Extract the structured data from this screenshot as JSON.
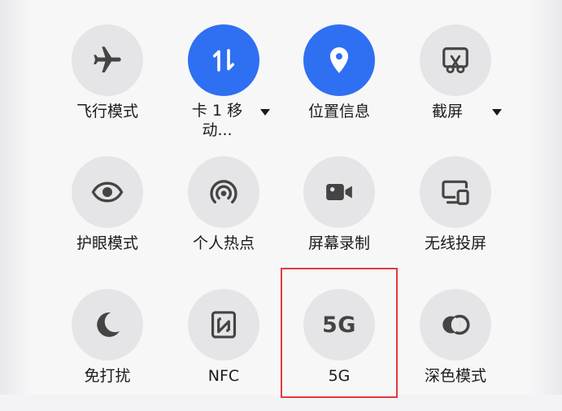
{
  "quick_settings": {
    "tiles": [
      {
        "id": "airplane",
        "label": "飞行模式",
        "icon": "airplane-icon",
        "active": false
      },
      {
        "id": "sim",
        "label_line1": "卡 1 移",
        "label_line2": "动...",
        "icon": "data-transfer-icon",
        "active": true,
        "has_dropdown": true
      },
      {
        "id": "location",
        "label": "位置信息",
        "icon": "location-pin-icon",
        "active": true
      },
      {
        "id": "screenshot",
        "label": "截屏",
        "icon": "screenshot-scissors-icon",
        "active": false,
        "has_dropdown": true
      },
      {
        "id": "eye-comfort",
        "label": "护眼模式",
        "icon": "eye-icon",
        "active": false
      },
      {
        "id": "hotspot",
        "label": "个人热点",
        "icon": "hotspot-icon",
        "active": false
      },
      {
        "id": "screen-record",
        "label": "屏幕录制",
        "icon": "video-camera-icon",
        "active": false
      },
      {
        "id": "wireless-projection",
        "label": "无线投屏",
        "icon": "cast-screen-icon",
        "active": false
      },
      {
        "id": "dnd",
        "label": "免打扰",
        "icon": "moon-icon",
        "active": false
      },
      {
        "id": "nfc",
        "label": "NFC",
        "icon": "nfc-icon",
        "active": false
      },
      {
        "id": "5g",
        "label": "5G",
        "icon_text": "5G",
        "icon": "5g-icon",
        "active": false
      },
      {
        "id": "dark-mode",
        "label": "深色模式",
        "icon": "dark-mode-icon",
        "active": false
      }
    ]
  },
  "colors": {
    "active": "#2f6ff2",
    "inactive": "#e5e5e7",
    "icon": "#444444",
    "highlight": "#e23b3b"
  }
}
